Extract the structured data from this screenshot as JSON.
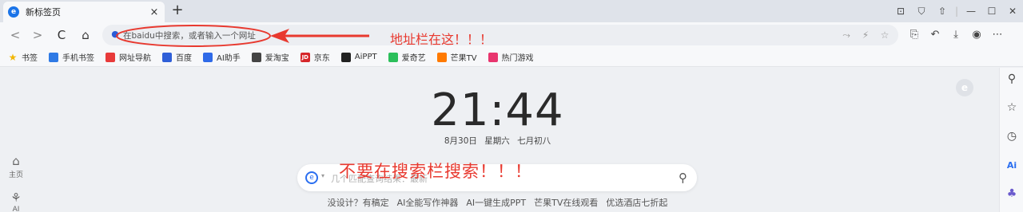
{
  "tab": {
    "title": "新标签页",
    "favicon": "e-icon",
    "close": "×"
  },
  "new_tab": "+",
  "window_controls": [
    "⊡",
    "⛉",
    "⇧",
    "|",
    "—",
    "☐",
    "✕"
  ],
  "nav": {
    "back": "<",
    "forward": ">",
    "reload": "C",
    "home": "⌂"
  },
  "address_bar": {
    "placeholder": "在baidu中搜索，或者输入一个网址"
  },
  "address_right_icons": [
    "⤳",
    "⚡",
    "☆"
  ],
  "toolbar_right": [
    "⎘",
    "↶",
    "⤓",
    "◉",
    "⋯"
  ],
  "bookmarks": [
    {
      "label": "书签",
      "icon_color": "#f2b705",
      "glyph": "★"
    },
    {
      "label": "手机书签",
      "icon_color": "#2f7ae5",
      "glyph": ""
    },
    {
      "label": "网址导航",
      "icon_color": "#e83a3a",
      "glyph": ""
    },
    {
      "label": "百度",
      "icon_color": "#2f5fd8",
      "glyph": ""
    },
    {
      "label": "AI助手",
      "icon_color": "#2f6ae8",
      "glyph": ""
    },
    {
      "label": "爱淘宝",
      "icon_color": "#444444",
      "glyph": ""
    },
    {
      "label": "京东",
      "icon_color": "#d6262a",
      "glyph": "JD"
    },
    {
      "label": "AiPPT",
      "icon_color": "#222222",
      "glyph": ""
    },
    {
      "label": "爱奇艺",
      "icon_color": "#2cbf5b",
      "glyph": ""
    },
    {
      "label": "芒果TV",
      "icon_color": "#ff7a00",
      "glyph": ""
    },
    {
      "label": "热门游戏",
      "icon_color": "#e8356e",
      "glyph": ""
    }
  ],
  "left_rail": [
    {
      "label": "主页",
      "icon": "home-icon",
      "glyph": "⌂"
    },
    {
      "label": "AI",
      "icon": "ai-icon",
      "glyph": "⚘"
    }
  ],
  "right_rail": [
    "⚲",
    "☆",
    "◷",
    "Ai",
    "♣"
  ],
  "clock": {
    "time": "21:44",
    "date": "8月30日",
    "weekday": "星期六",
    "lunar": "七月初八"
  },
  "search": {
    "placeholder": "几个匹配查询结果：最新"
  },
  "hotwords": [
    "没设计？有稿定",
    "AI全能写作神器",
    "AI一键生成PPT",
    "芒果TV在线观看",
    "优选酒店七折起"
  ],
  "annotations": {
    "address": "地址栏在这！！！",
    "search": "不要在搜索栏搜索！！！",
    "color": "#e8392f"
  }
}
